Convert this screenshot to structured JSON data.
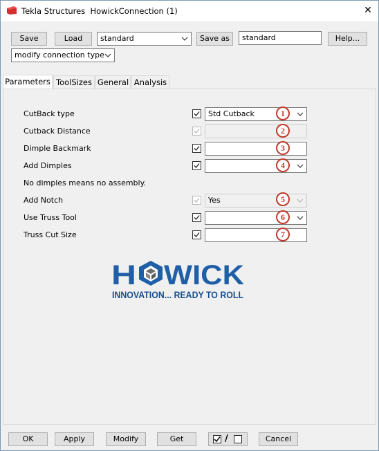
{
  "window": {
    "title": "Tekla Structures  HowickConnection (1)",
    "close_glyph": "✕"
  },
  "toolbar": {
    "save_label": "Save",
    "load_label": "Load",
    "preset_value": "standard",
    "save_as_label": "Save as",
    "save_as_value": "standard",
    "help_label": "Help...",
    "mode_value": "modify connection type"
  },
  "tabs": [
    "Parameters",
    "ToolSizes",
    "General",
    "Analysis"
  ],
  "params": {
    "cutback_type": {
      "label": "CutBack type",
      "value": "Std Cutback",
      "badge": "1"
    },
    "cutback_distance": {
      "label": "Cutback Distance",
      "value": "",
      "badge": "2"
    },
    "dimple_backmark": {
      "label": "Dimple Backmark",
      "value": "",
      "badge": "3"
    },
    "add_dimples": {
      "label": "Add Dimples",
      "value": "",
      "badge": "4"
    },
    "note": "No dimples means no assembly.",
    "add_notch": {
      "label": "Add Notch",
      "value": "Yes",
      "badge": "5"
    },
    "use_truss_tool": {
      "label": "Use Truss Tool",
      "value": "",
      "badge": "6"
    },
    "truss_cut_size": {
      "label": "Truss Cut Size",
      "value": "",
      "badge": "7"
    }
  },
  "logo": {
    "brand": "HOWICK",
    "tagline": "INNOVATION... READY TO ROLL",
    "colors": {
      "blue": "#1f5fa8",
      "dark_blue": "#184f8f",
      "gray": "#6b6b6b"
    }
  },
  "bottom": {
    "ok_label": "OK",
    "apply_label": "Apply",
    "modify_label": "Modify",
    "get_label": "Get",
    "toggle_separator": "/",
    "cancel_label": "Cancel"
  },
  "colors": {
    "badge_red": "#c0392b",
    "window_bg": "#f0f0f0",
    "app_icon_red": "#d32f2f"
  }
}
